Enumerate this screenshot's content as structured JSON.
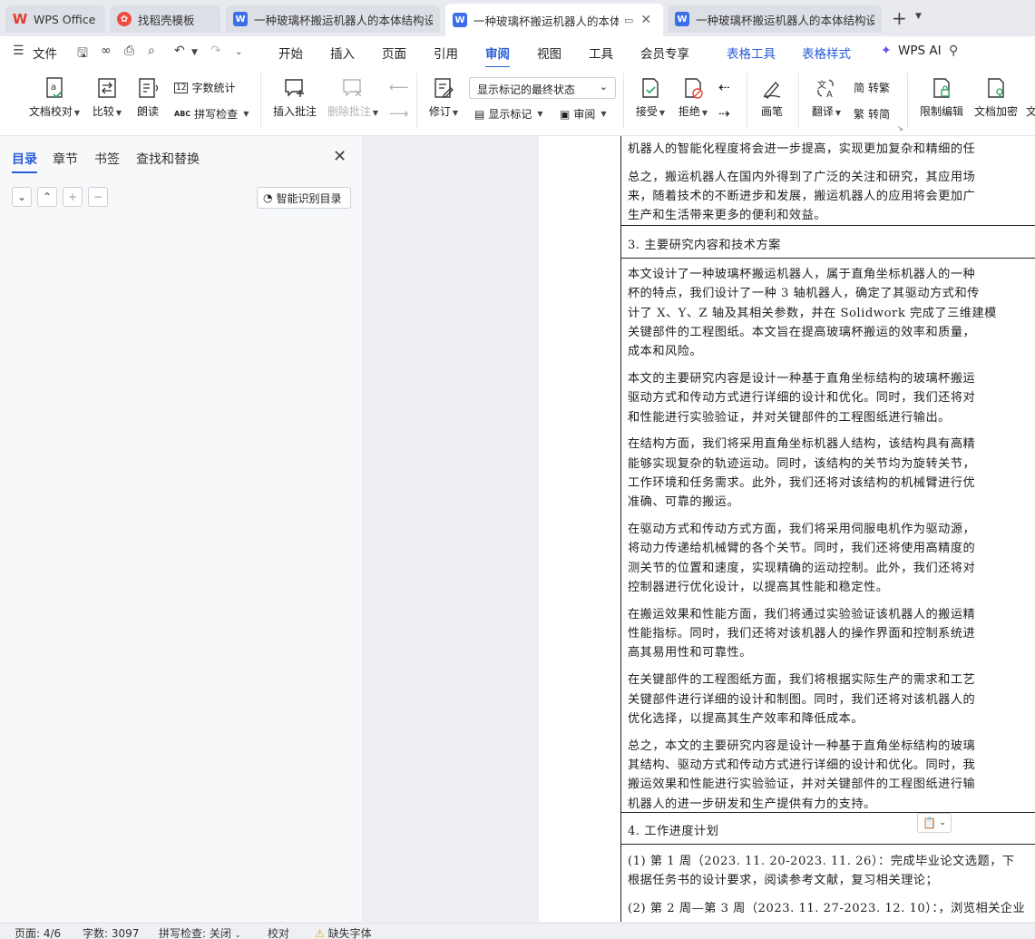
{
  "tabs": [
    {
      "label": "WPS Office",
      "icon": "wps-logo-icon"
    },
    {
      "label": "找稻壳模板",
      "icon": "docer-icon"
    },
    {
      "label": "一种玻璃杯搬运机器人的本体结构设计",
      "icon": "writer-doc-icon"
    },
    {
      "label": "一种玻璃杯搬运机器人的本体结构设计",
      "icon": "writer-doc-icon"
    },
    {
      "label": "一种玻璃杯搬运机器人的本体结构设计",
      "icon": "writer-doc-icon"
    }
  ],
  "menu": {
    "file": "文件",
    "items": [
      "开始",
      "插入",
      "页面",
      "引用",
      "审阅",
      "视图",
      "工具",
      "会员专享",
      "表格工具",
      "表格样式",
      "WPS AI"
    ],
    "selected": "审阅"
  },
  "ribbon": {
    "proofread": "文档校对",
    "compare": "比较",
    "read_aloud": "朗读",
    "word_count": "字数统计",
    "spell_check": "拼写检查",
    "insert_comment": "插入批注",
    "delete_comment": "删除批注",
    "revise": "修订",
    "markup_state": "显示标记的最终状态",
    "show_markup": "显示标记",
    "review": "审阅",
    "accept": "接受",
    "reject": "拒绝",
    "pen": "画笔",
    "translate": "翻译",
    "to_traditional": "转繁",
    "to_simplified": "转简",
    "restrict_edit": "限制编辑",
    "encrypt_doc": "文档加密",
    "more": "文"
  },
  "left_panel": {
    "tabs": [
      "目录",
      "章节",
      "书签",
      "查找和替换"
    ],
    "smart_toc": "智能识别目录"
  },
  "document": {
    "lines_top": [
      "机器人的智能化程度将会进一步提高，实现更加复杂和精细的任",
      "总之，搬运机器人在国内外得到了广泛的关注和研究，其应用场",
      "来，随着技术的不断进步和发展，搬运机器人的应用将会更加广",
      "生产和生活带来更多的便利和效益。"
    ],
    "section3_title": "3. 主要研究内容和技术方案",
    "section3_lines": [
      "本文设计了一种玻璃杯搬运机器人，属于直角坐标机器人的一种",
      "杯的特点，我们设计了一种 3 轴机器人，确定了其驱动方式和传",
      "计了 X、Y、Z 轴及其相关参数，并在 Solidwork 完成了三维建模",
      "关键部件的工程图纸。本文旨在提高玻璃杯搬运的效率和质量，",
      "成本和风险。",
      "本文的主要研究内容是设计一种基于直角坐标结构的玻璃杯搬运",
      "驱动方式和传动方式进行详细的设计和优化。同时，我们还将对",
      "和性能进行实验验证，并对关键部件的工程图纸进行输出。",
      "在结构方面，我们将采用直角坐标机器人结构，该结构具有高精",
      "能够实现复杂的轨迹运动。同时，该结构的关节均为旋转关节，",
      "工作环境和任务需求。此外，我们还将对该结构的机械臂进行优",
      "准确、可靠的搬运。",
      "在驱动方式和传动方式方面，我们将采用伺服电机作为驱动源，",
      "将动力传递给机械臂的各个关节。同时，我们还将使用高精度的",
      "测关节的位置和速度，实现精确的运动控制。此外，我们还将对",
      "控制器进行优化设计，以提高其性能和稳定性。",
      "在搬运效果和性能方面，我们将通过实验验证该机器人的搬运精",
      "性能指标。同时，我们还将对该机器人的操作界面和控制系统进",
      "高其易用性和可靠性。",
      "在关键部件的工程图纸方面，我们将根据实际生产的需求和工艺",
      "关键部件进行详细的设计和制图。同时，我们还将对该机器人的",
      "优化选择，以提高其生产效率和降低成本。",
      "总之，本文的主要研究内容是设计一种基于直角坐标结构的玻璃",
      "其结构、驱动方式和传动方式进行详细的设计和优化。同时，我",
      "搬运效果和性能进行实验验证，并对关键部件的工程图纸进行输",
      "机器人的进一步研发和生产提供有力的支持。"
    ],
    "section4_title": "4. 工作进度计划",
    "section4_lines": [
      "(1)  第 1 周（2023. 11. 20-2023. 11. 26）：完成毕业论文选题，下",
      "根据任务书的设计要求，阅读参考文献，复习相关理论；",
      "(2)  第 2 周—第 3 周（2023. 11. 27-2023. 12. 10）：，浏览相关企业"
    ]
  },
  "status": {
    "page": "页面: 4/6",
    "words": "字数: 3097",
    "spell": "拼写检查: 关闭",
    "proof": "校对",
    "missing_font": "缺失字体"
  },
  "colors": {
    "accent": "#2a5cd7",
    "wps_red": "#e43a2f",
    "doc_blue": "#3b6fe8"
  }
}
